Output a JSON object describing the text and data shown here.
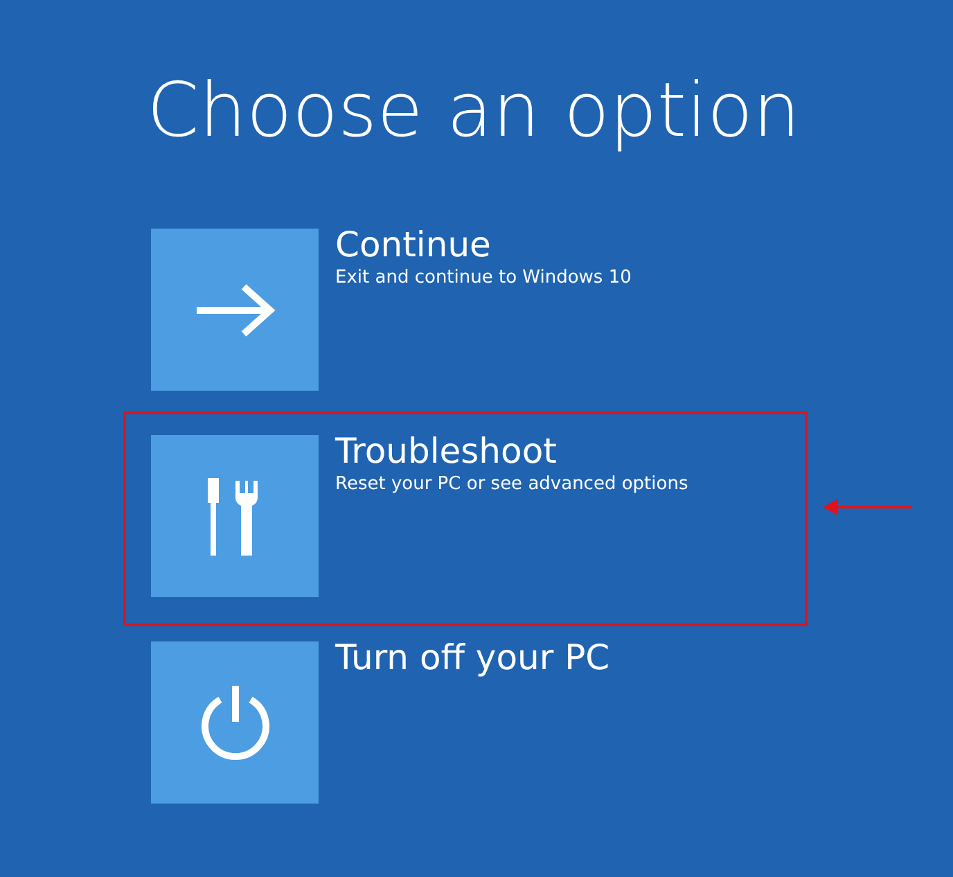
{
  "title": "Choose an option",
  "options": [
    {
      "kind": "continue",
      "label": "Continue",
      "description": "Exit and continue to Windows 10",
      "highlighted": false
    },
    {
      "kind": "troubleshoot",
      "label": "Troubleshoot",
      "description": "Reset your PC or see advanced options",
      "highlighted": true
    },
    {
      "kind": "power",
      "label": "Turn off your PC",
      "highlighted": false
    }
  ]
}
